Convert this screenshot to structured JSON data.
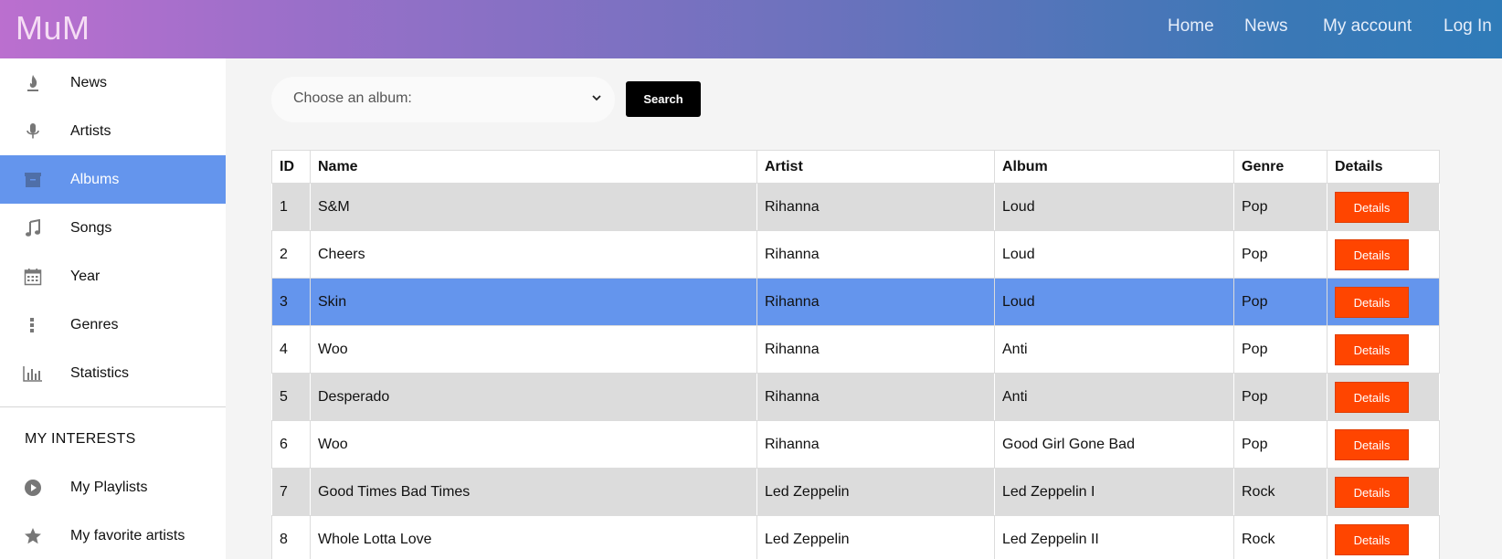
{
  "app": {
    "logo": "MuM"
  },
  "topnav": {
    "home": "Home",
    "news": "News",
    "account": "My account",
    "login": "Log In"
  },
  "sidebar": {
    "items": [
      {
        "label": "News",
        "icon": "fire-icon"
      },
      {
        "label": "Artists",
        "icon": "microphone-icon"
      },
      {
        "label": "Albums",
        "icon": "album-icon",
        "active": true
      },
      {
        "label": "Songs",
        "icon": "music-note-icon"
      },
      {
        "label": "Year",
        "icon": "calendar-icon"
      },
      {
        "label": "Genres",
        "icon": "dots-vertical-icon"
      },
      {
        "label": "Statistics",
        "icon": "bar-chart-icon"
      }
    ],
    "interests_heading": "MY INTERESTS",
    "interests": [
      {
        "label": "My Playlists",
        "icon": "play-circle-icon"
      },
      {
        "label": "My favorite artists",
        "icon": "star-icon"
      }
    ]
  },
  "search": {
    "placeholder": "Choose an album:",
    "button": "Search"
  },
  "table": {
    "headers": [
      "ID",
      "Name",
      "Artist",
      "Album",
      "Genre",
      "Details"
    ],
    "details_label": "Details",
    "rows": [
      {
        "id": "1",
        "name": "S&M",
        "artist": "Rihanna",
        "album": "Loud",
        "genre": "Pop"
      },
      {
        "id": "2",
        "name": "Cheers",
        "artist": "Rihanna",
        "album": "Loud",
        "genre": "Pop"
      },
      {
        "id": "3",
        "name": "Skin",
        "artist": "Rihanna",
        "album": "Loud",
        "genre": "Pop"
      },
      {
        "id": "4",
        "name": "Woo",
        "artist": "Rihanna",
        "album": "Anti",
        "genre": "Pop"
      },
      {
        "id": "5",
        "name": "Desperado",
        "artist": "Rihanna",
        "album": "Anti",
        "genre": "Pop"
      },
      {
        "id": "6",
        "name": "Woo",
        "artist": "Rihanna",
        "album": "Good Girl Gone Bad",
        "genre": "Pop"
      },
      {
        "id": "7",
        "name": "Good Times Bad Times",
        "artist": "Led Zeppelin",
        "album": "Led Zeppelin I",
        "genre": "Rock"
      },
      {
        "id": "8",
        "name": "Whole Lotta Love",
        "artist": "Led Zeppelin",
        "album": "Led Zeppelin II",
        "genre": "Rock"
      }
    ]
  },
  "colors": {
    "active": "#6495ed",
    "details_button": "#ff4500",
    "row_alt": "#dcdcdc"
  }
}
